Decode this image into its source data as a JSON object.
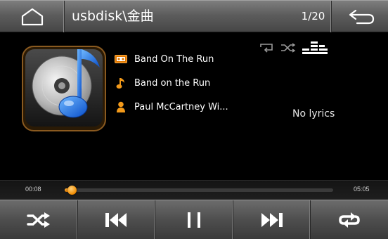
{
  "header": {
    "title": "usbdisk\\金曲",
    "track_counter": "1/20"
  },
  "track": {
    "album": "Band On The Run",
    "title": "Band on the Run",
    "artist": "Paul McCartney  Wi..."
  },
  "lyrics": {
    "status": "No lyrics"
  },
  "progress": {
    "current_time": "00:08",
    "total_time": "05:05",
    "fraction": 0.026
  },
  "icons": {
    "header": [
      "home-icon",
      "back-arrow-icon"
    ],
    "info": [
      "album-icon",
      "note-icon",
      "artist-icon"
    ],
    "modes": [
      "repeat-icon",
      "shuffle-icon",
      "equalizer-icon"
    ],
    "controls": [
      "shuffle-icon",
      "previous-track-icon",
      "pause-icon",
      "next-track-icon",
      "repeat-icon"
    ]
  },
  "colors": {
    "accent": "#f08a00",
    "bar": "#5a5a5a",
    "background": "#000000"
  }
}
